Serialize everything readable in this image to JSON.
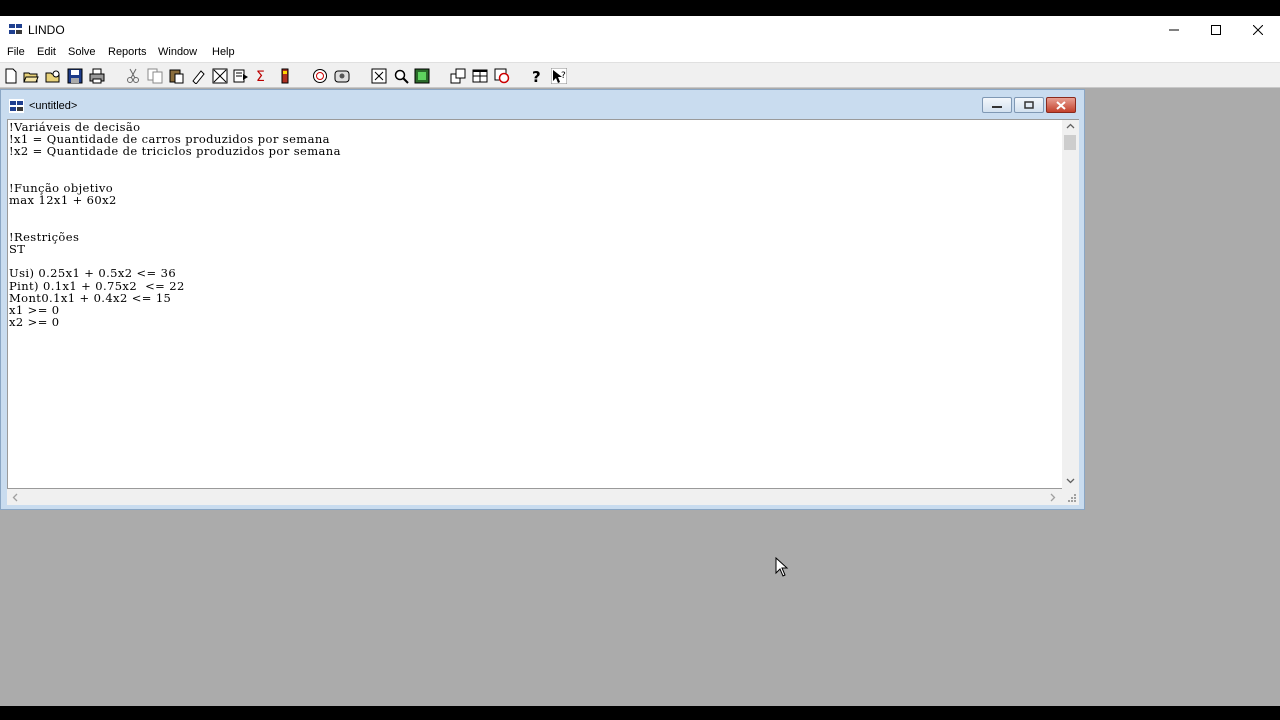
{
  "window": {
    "title": "LINDO"
  },
  "menu": {
    "items": [
      "File",
      "Edit",
      "Solve",
      "Reports",
      "Window",
      "Help"
    ]
  },
  "toolbar": {
    "buttons": [
      "new-icon",
      "open-icon",
      "view-icon",
      "save-icon",
      "print-icon",
      "cut-icon",
      "copy-icon",
      "paste-icon",
      "clear-icon",
      "clear-all-icon",
      "find-icon",
      "goto-line-icon",
      "solve-icon",
      "compile-icon",
      "options-icon",
      "send-to-back-icon",
      "close-all-icon",
      "tile-icon",
      "cascade-icon",
      "title-icon",
      "help-icon",
      "context-help-icon"
    ]
  },
  "child": {
    "title": "<untitled>",
    "lines": [
      "!Variáveis de decisão",
      "!x1 = Quantidade de carros produzidos por semana",
      "!x2 = Quantidade de triciclos produzidos por semana",
      "",
      "",
      "!Função objetivo",
      "max 12x1 + 60x2",
      "",
      "",
      "!Restrições",
      "ST",
      "",
      "Usi) 0.25x1 + 0.5x2 <= 36",
      "Pint) 0.1x1 + 0.75x2  <= 22",
      "Mont0.1x1 + 0.4x2 <= 15",
      "x1 >= 0",
      "x2 >= 0"
    ]
  },
  "icons": {
    "minimize": "minimize-icon",
    "maximize": "maximize-icon",
    "close": "close-icon"
  },
  "colors": {
    "mdi_background": "#ababab",
    "child_frame": "#c9dcef",
    "close_button": "#c3412c"
  }
}
